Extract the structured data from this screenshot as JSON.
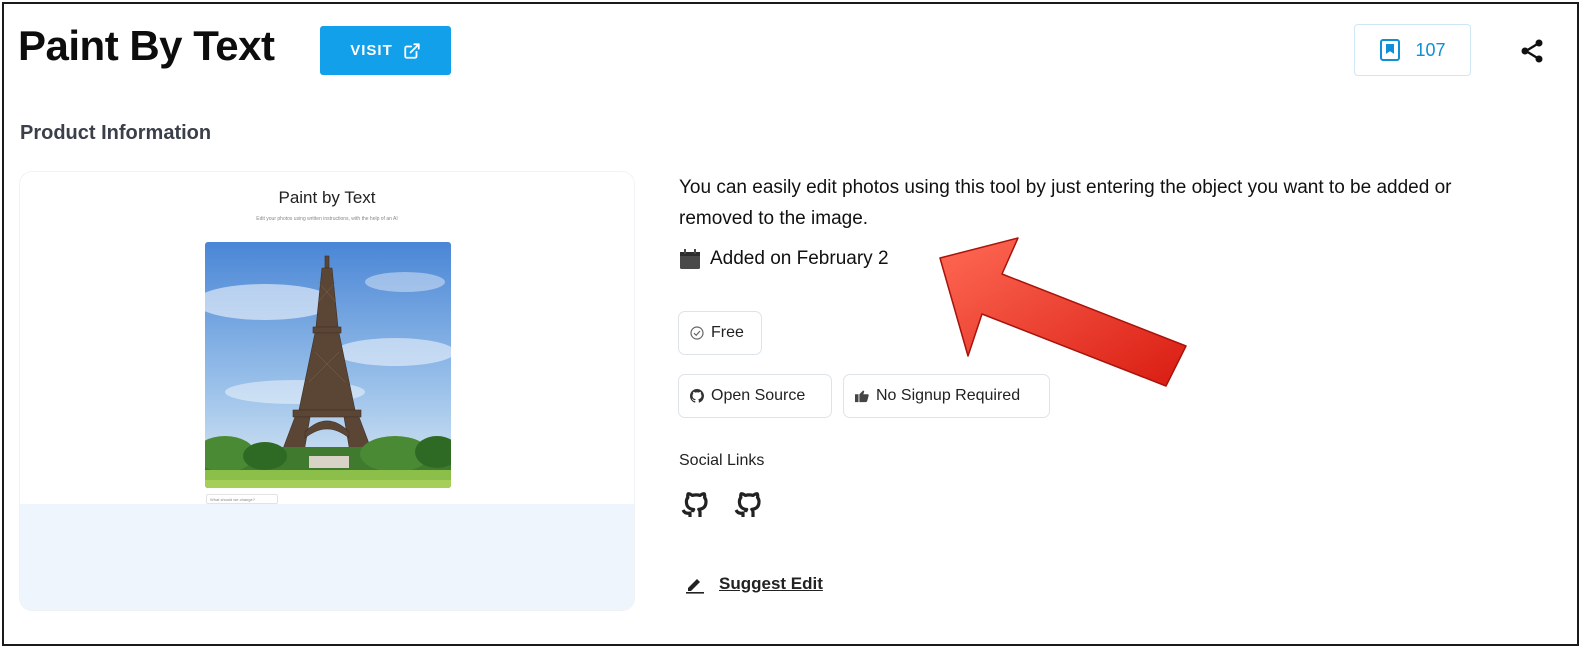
{
  "header": {
    "title": "Paint By Text",
    "visit_label": "VISIT",
    "bookmark_count": "107"
  },
  "product_info": {
    "section_title": "Product Information",
    "preview": {
      "title": "Paint by Text",
      "subtitle": "Edit your photos using written instructions, with the help of an AI",
      "input_placeholder": "What should we change?"
    },
    "description": "You can easily edit photos using this tool by just entering the object you want to be added or removed to the image.",
    "added_on": "Added on February 2",
    "tags": {
      "free": "Free",
      "open_source": "Open Source",
      "no_signup": "No Signup Required"
    },
    "social_links_label": "Social Links",
    "suggest_edit": "Suggest Edit"
  },
  "colors": {
    "accent": "#12a0ea",
    "bookmark": "#0e8fd6",
    "annotation_arrow": "#e8261b",
    "preview_bg": "#eff5fd"
  },
  "icons": [
    "external-link-icon",
    "bookmark-icon",
    "share-icon",
    "calendar-icon",
    "check-circle-icon",
    "github-icon",
    "thumbs-up-icon",
    "pencil-icon"
  ]
}
